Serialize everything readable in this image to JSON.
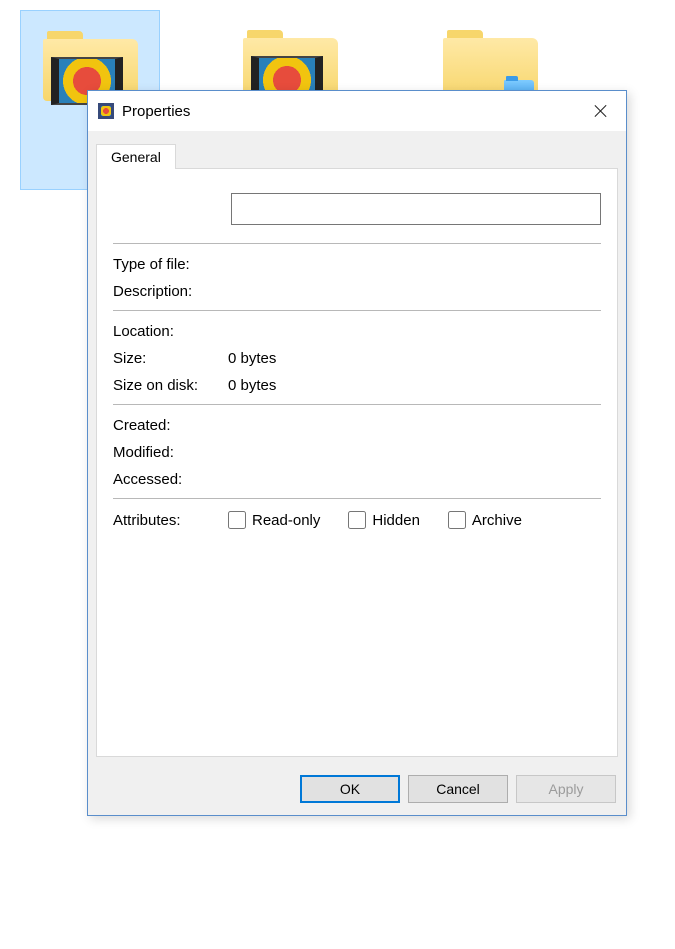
{
  "dialog": {
    "title": "Properties",
    "tab": "General",
    "name_value": "",
    "labels": {
      "type_of_file": "Type of file:",
      "description": "Description:",
      "location": "Location:",
      "size": "Size:",
      "size_on_disk": "Size on disk:",
      "created": "Created:",
      "modified": "Modified:",
      "accessed": "Accessed:",
      "attributes": "Attributes:"
    },
    "values": {
      "type_of_file": "",
      "description": "",
      "location": "",
      "size": "0 bytes",
      "size_on_disk": "0 bytes",
      "created": "",
      "modified": "",
      "accessed": ""
    },
    "attributes": {
      "readonly_label": "Read-only",
      "hidden_label": "Hidden",
      "archive_label": "Archive",
      "readonly_checked": false,
      "hidden_checked": false,
      "archive_checked": false
    },
    "buttons": {
      "ok": "OK",
      "cancel": "Cancel",
      "apply": "Apply"
    }
  }
}
